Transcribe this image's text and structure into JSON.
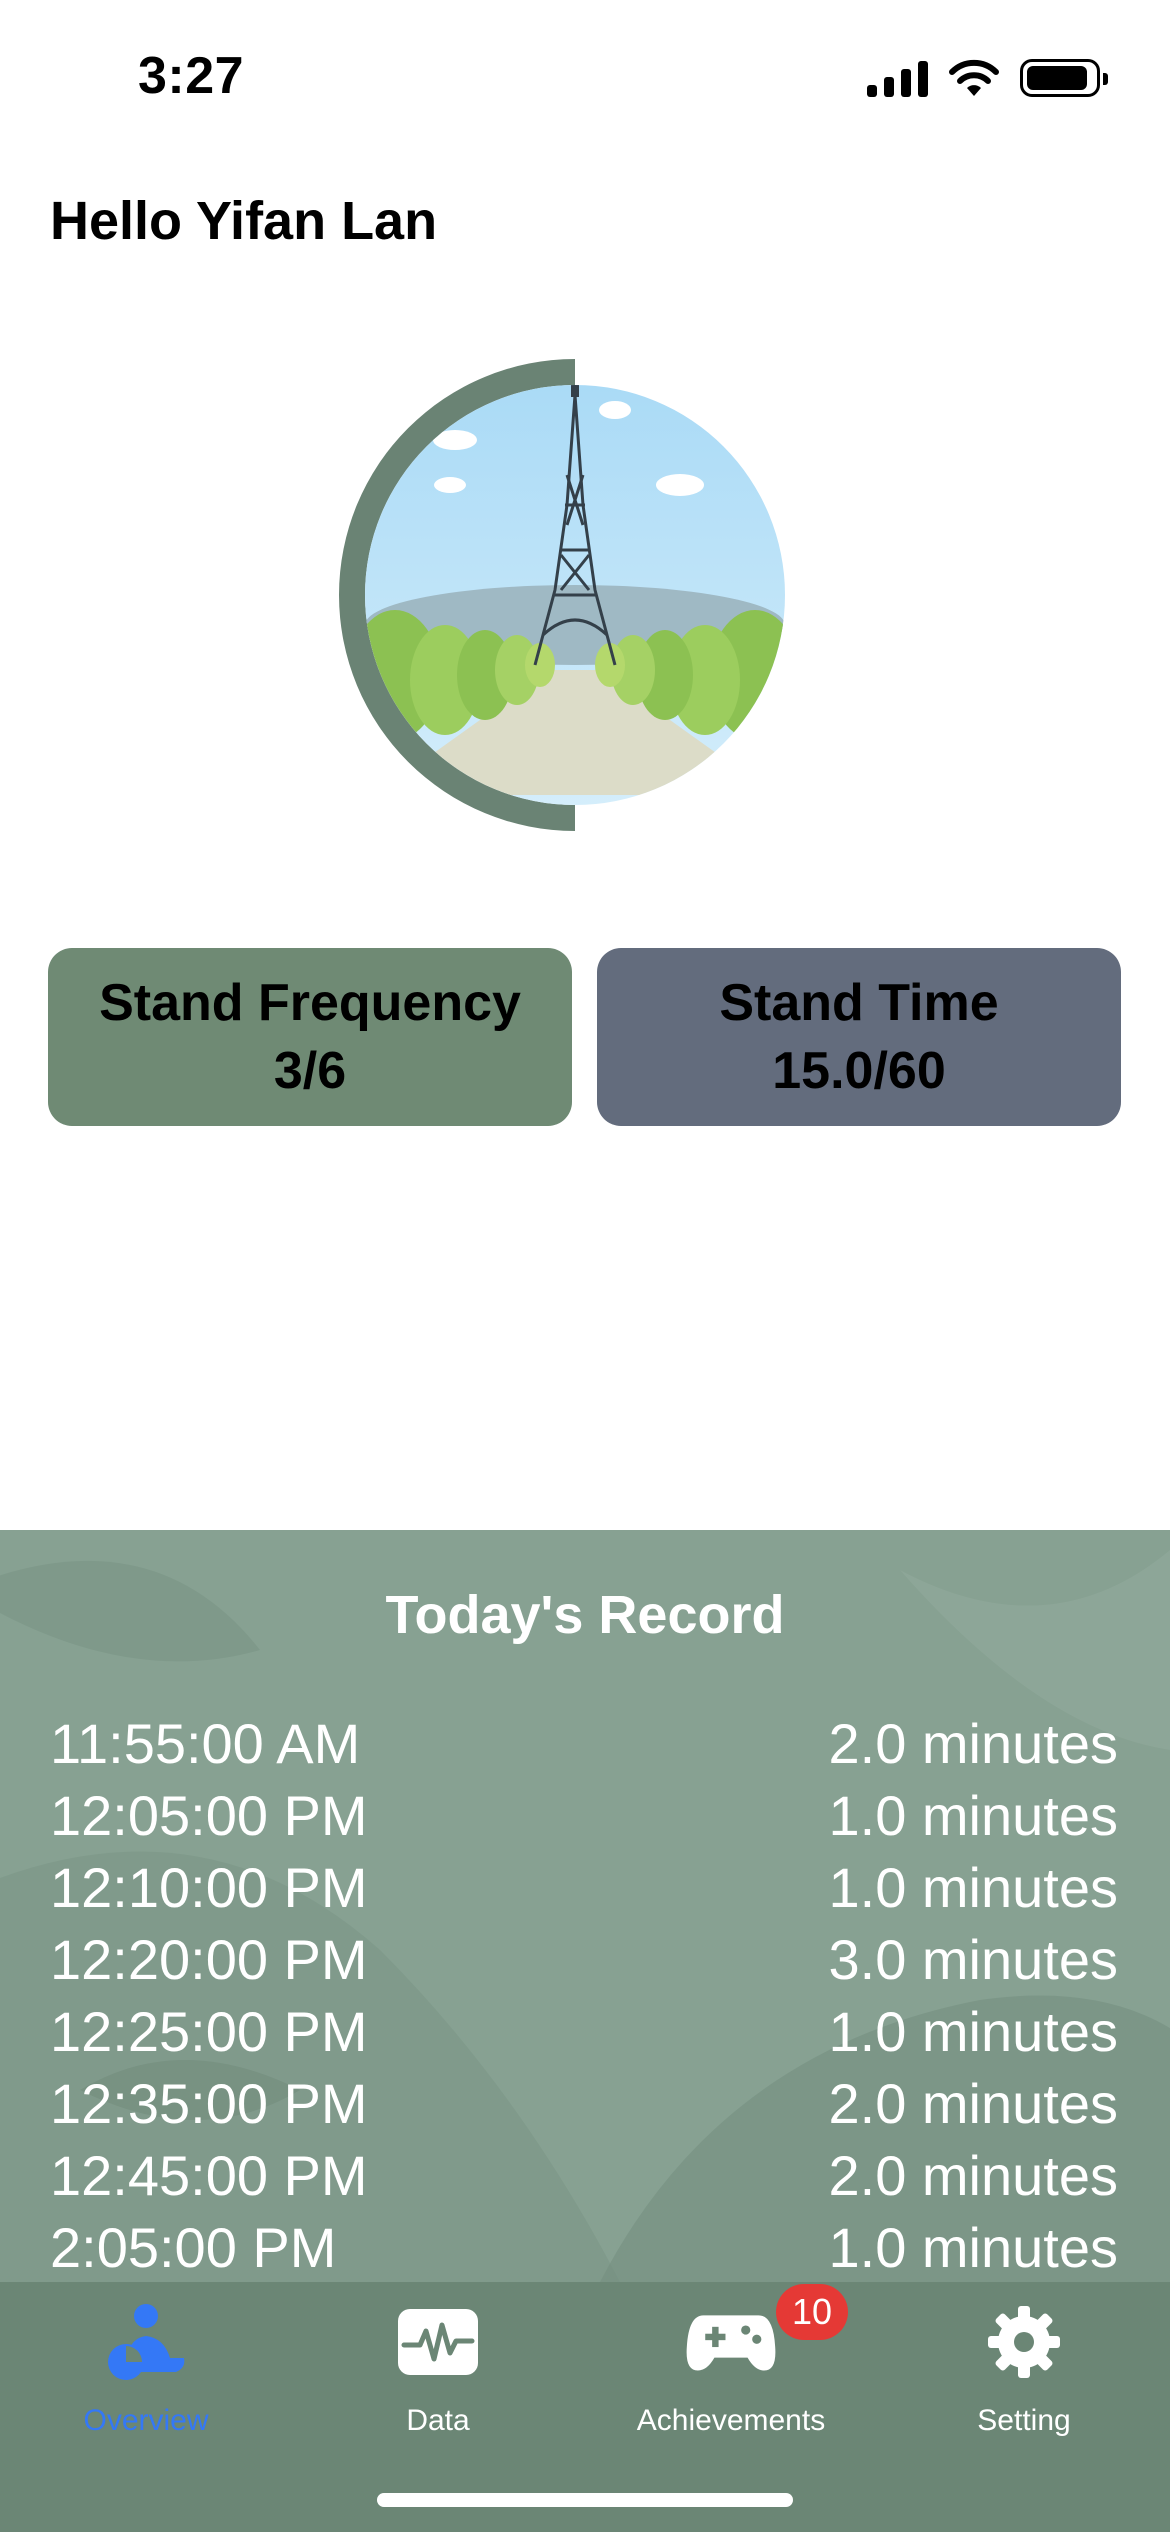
{
  "status_bar": {
    "time": "3:27"
  },
  "greeting": "Hello Yifan Lan",
  "progress_ring": {
    "fraction": 0.5,
    "color": "#6a8374"
  },
  "stats": {
    "frequency": {
      "label": "Stand Frequency",
      "value": "3/6"
    },
    "time": {
      "label": "Stand Time",
      "value": "15.0/60"
    }
  },
  "record": {
    "title": "Today's Record",
    "rows": [
      {
        "time": "11:55:00 AM",
        "duration": "2.0 minutes"
      },
      {
        "time": "12:05:00 PM",
        "duration": "1.0 minutes"
      },
      {
        "time": "12:10:00 PM",
        "duration": "1.0 minutes"
      },
      {
        "time": "12:20:00 PM",
        "duration": "3.0 minutes"
      },
      {
        "time": "12:25:00 PM",
        "duration": "1.0 minutes"
      },
      {
        "time": "12:35:00 PM",
        "duration": "2.0 minutes"
      },
      {
        "time": "12:45:00 PM",
        "duration": "2.0 minutes"
      },
      {
        "time": "2:05:00 PM",
        "duration": "1.0 minutes"
      }
    ]
  },
  "tabs": [
    {
      "label": "Overview",
      "icon": "person-chart-icon",
      "active": true
    },
    {
      "label": "Data",
      "icon": "waveform-icon",
      "active": false
    },
    {
      "label": "Achievements",
      "icon": "gamecontroller-icon",
      "active": false
    },
    {
      "label": "Setting",
      "icon": "gear-icon",
      "active": false
    }
  ],
  "achievements_badge": "10",
  "colors": {
    "accent": "#3478f6",
    "card_frequency": "#6f8a74",
    "card_time": "#636c7d",
    "record_panel": "#87a192",
    "tab_bar": "#6b8675",
    "badge": "#e53935"
  }
}
